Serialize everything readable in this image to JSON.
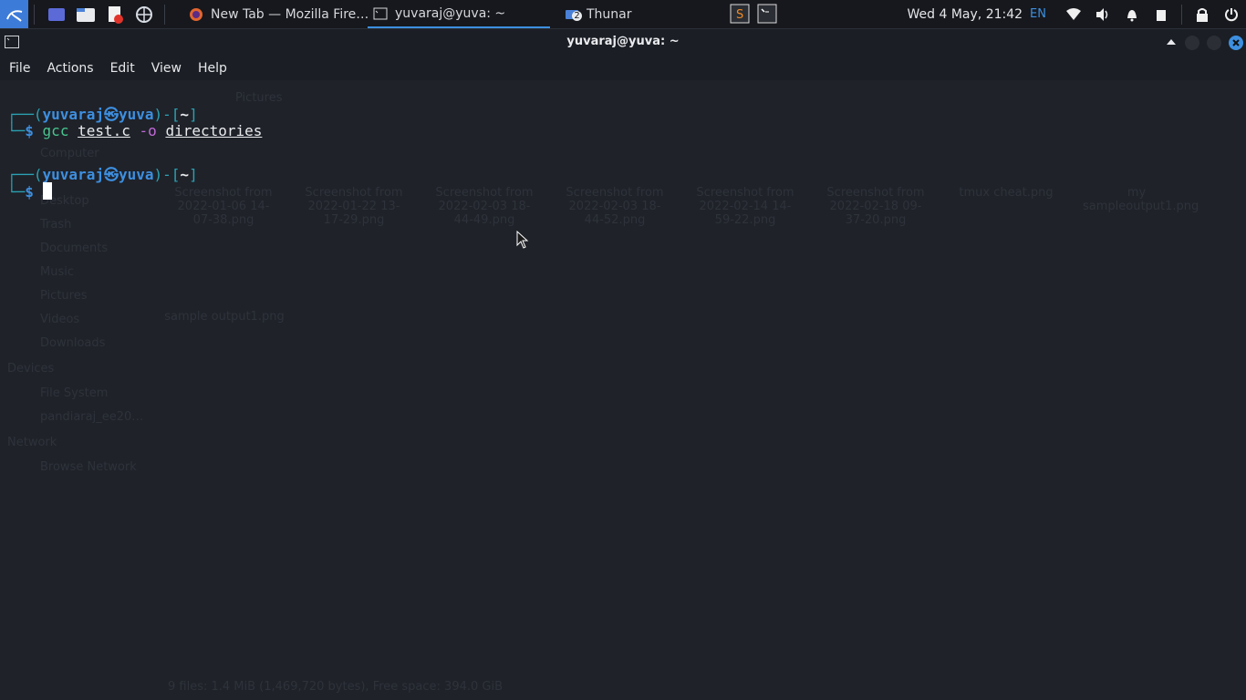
{
  "taskbar": {
    "tasks": [
      {
        "label": "New Tab — Mozilla Fire…"
      },
      {
        "label": "yuvaraj@yuva: ~"
      },
      {
        "label": "Thunar",
        "badge": "2"
      }
    ],
    "clock": "Wed  4 May, 21:42",
    "lang": "EN"
  },
  "window": {
    "title": "yuvaraj@yuva: ~",
    "menus": [
      "File",
      "Actions",
      "Edit",
      "View",
      "Help"
    ]
  },
  "terminal": {
    "user": "yuvaraj",
    "host": "yuva",
    "at": "㉿",
    "dir": "~",
    "cmd": "gcc",
    "arg1": "test.c",
    "flag": "-o",
    "arg2": "directories",
    "prompt": "$"
  },
  "colors": {
    "accent": "#3d8fe0",
    "bracket": "#2aa1b3",
    "command": "#48c58e",
    "flag": "#c16ad8",
    "background": "#1f2229"
  },
  "background_window": {
    "sidebar": [
      "Computer",
      "Desktop",
      "Trash",
      "Documents",
      "Music",
      "Pictures",
      "Videos",
      "Downloads",
      "Devices",
      "File System",
      "pandiaraj_ee20…",
      "Network",
      "Browse Network"
    ],
    "files": [
      "Screenshot from 2022-01-06 14-07-38.png",
      "Screenshot from 2022-01-22 13-17-29.png",
      "Screenshot from 2022-02-03 18-44-49.png",
      "Screenshot from 2022-02-03 18-44-52.png",
      "Screenshot from 2022-02-14 14-59-22.png",
      "Screenshot from 2022-02-18 09-37-20.png",
      "tmux cheat.png",
      "my sampleoutput1.png",
      "sample output1.png"
    ],
    "status": "9 files: 1.4 MiB (1,469,720 bytes), Free space: 394.0 GiB",
    "path": "Pictures"
  }
}
